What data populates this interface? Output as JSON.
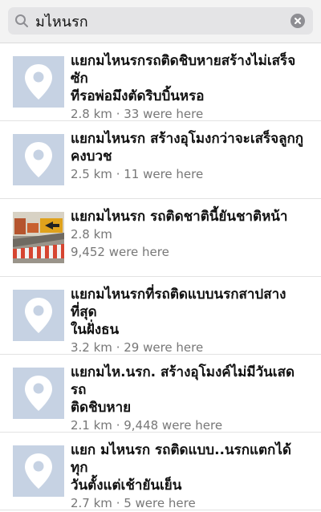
{
  "search": {
    "query": "มไหนรก",
    "icon": "search-icon",
    "clear_icon": "clear-icon"
  },
  "colors": {
    "placeholder_bg": "#c6d2e3",
    "meta_text": "#777777",
    "search_bg": "#e4e4e6"
  },
  "results": [
    {
      "title_line1": "แยกมไหนรกรถติดชิบหายสร้างไม่เสร็จซัก",
      "title_line2": "ทีรอพ่อมึงตัดริบบิ้นหรอ",
      "meta1": "2.8 km · 33 were here",
      "meta2": "",
      "thumb": "map-pin-icon"
    },
    {
      "title_line1": "แยกมไหนรก สร้างอุโมงกว่าจะเสร็จลูกกู",
      "title_line2": "คงบวช",
      "meta1": "2.5 km · 11 were here",
      "meta2": "",
      "thumb": "map-pin-icon"
    },
    {
      "title_line1": "แยกมไหนรก รถติดชาตินี้ยันชาติหน้า",
      "title_line2": "",
      "meta1": "2.8 km",
      "meta2": "9,452 were here",
      "thumb": "construction-photo"
    },
    {
      "title_line1": "แยกมไหนรกที่รถติดแบบนรกสาปสางที่สุด",
      "title_line2": "ในฝั่งธน",
      "meta1": "3.2 km · 29 were here",
      "meta2": "",
      "thumb": "map-pin-icon"
    },
    {
      "title_line1": "แยกมไห.นรก.  สร้างอุโมงค์ไม่มีวันเสด รถ",
      "title_line2": "ติดชิบหาย",
      "meta1": "2.1 km · 9,448 were here",
      "meta2": "",
      "thumb": "map-pin-icon"
    },
    {
      "title_line1": "แยก มไหนรก รถติดแบบ..นรกแตกได้ทุก",
      "title_line2": "วันตั้งแต่เช้ายันเย็น",
      "meta1": "2.7 km · 5 were here",
      "meta2": "",
      "thumb": "map-pin-icon"
    }
  ]
}
